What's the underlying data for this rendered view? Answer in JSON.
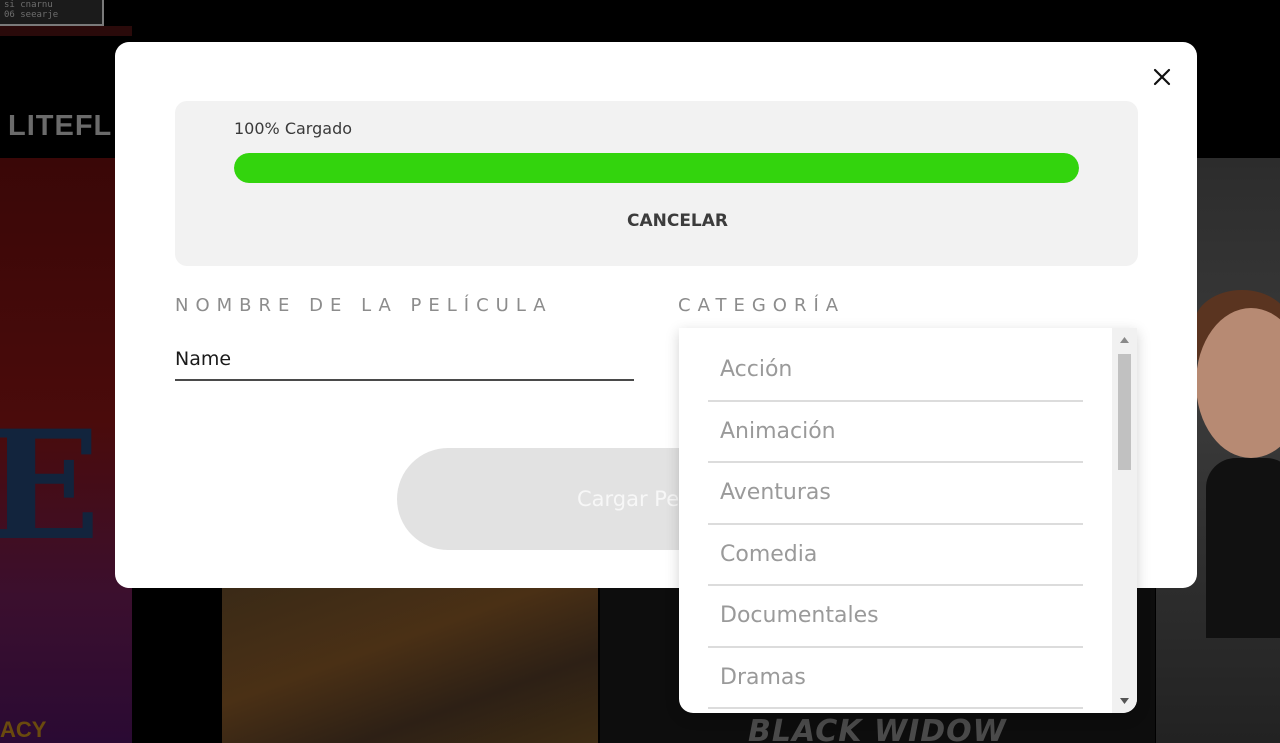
{
  "background": {
    "topbox_line1": "si cnarnu",
    "topbox_line2": "06 seearje",
    "logo_text": "LITEFL",
    "poster1_caption": "ACY",
    "poster3_caption": "BLACK WIDOW"
  },
  "modal": {
    "upload": {
      "progress_label": "100% Cargado",
      "progress_percent": 100,
      "progress_color": "#33d40d",
      "cancel_label": "CANCELAR"
    },
    "form": {
      "name_label": "NOMBRE DE LA PELÍCULA",
      "name_placeholder": "Name",
      "name_value": "",
      "category_label": "CATEGORÍA",
      "submit_label": "Cargar Pe"
    },
    "category_dropdown": {
      "options": [
        "Acción",
        "Animación",
        "Aventuras",
        "Comedia",
        "Documentales",
        "Dramas"
      ]
    },
    "close_icon": "close-icon"
  }
}
